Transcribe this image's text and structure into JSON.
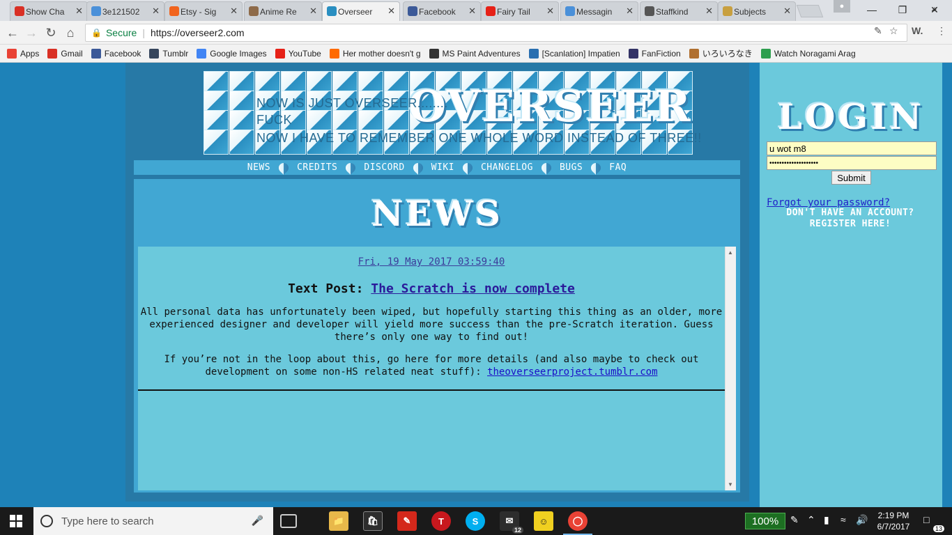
{
  "browser": {
    "tabs": [
      {
        "title": "Show Cha",
        "color": "#d93025"
      },
      {
        "title": "3e121502",
        "color": "#4a90d9"
      },
      {
        "title": "Etsy - Sig",
        "color": "#f1641e"
      },
      {
        "title": "Anime Re",
        "color": "#8e6b4a"
      },
      {
        "title": "Overseer",
        "color": "#2a8fc1",
        "active": true
      },
      {
        "title": "Facebook",
        "color": "#3b5998"
      },
      {
        "title": "Fairy Tail",
        "color": "#e62117"
      },
      {
        "title": "Messagin",
        "color": "#4a90d9"
      },
      {
        "title": "Staffkind",
        "color": "#555555"
      },
      {
        "title": "Subjects",
        "color": "#c8a040"
      }
    ],
    "secure_label": "Secure",
    "url": "https://overseer2.com",
    "bookmarks": [
      {
        "label": "Apps",
        "color": "#e94235"
      },
      {
        "label": "Gmail",
        "color": "#d93025"
      },
      {
        "label": "Facebook",
        "color": "#3b5998"
      },
      {
        "label": "Tumblr",
        "color": "#36465d"
      },
      {
        "label": "Google Images",
        "color": "#4285f4"
      },
      {
        "label": "YouTube",
        "color": "#e62117"
      },
      {
        "label": "Her mother doesn't g",
        "color": "#ff6a00"
      },
      {
        "label": "MS Paint Adventures",
        "color": "#333333"
      },
      {
        "label": "[Scanlation] Impatien",
        "color": "#2a6fb0"
      },
      {
        "label": "FanFiction",
        "color": "#333366"
      },
      {
        "label": "いろいろなき",
        "color": "#b07030"
      },
      {
        "label": "Watch Noragami Arag",
        "color": "#2e9e4f"
      }
    ]
  },
  "site": {
    "logo_text": "OVERSEER",
    "header_lines": [
      "NOW IS JUST OVERSEER........",
      "FUCK",
      "NOW I HAVE TO REMEMBER ONE WHOLE WORD INSTEAD OF THREE!!"
    ],
    "nav": [
      "NEWS",
      "CREDITS",
      "DISCORD",
      "WIKI",
      "CHANGELOG",
      "BUGS",
      "FAQ"
    ],
    "news_title": "NEWS",
    "post": {
      "date": "Fri, 19 May 2017 03:59:40",
      "type_label": "Text Post:",
      "title": "The Scratch is now complete",
      "para1": "All personal data has unfortunately been wiped, but hopefully starting this thing as an older, more experienced designer and developer will yield more success than the pre-Scratch iteration. Guess there’s only one way to find out!",
      "para2": "If you’re not in the loop about this, go here for more details (and also maybe to check out development on some non-HS related neat stuff): ",
      "link": "theoverseerproject.tumblr.com"
    },
    "login": {
      "title": "LOGIN",
      "username": "u wot m8",
      "password": "••••••••••••••••••••",
      "submit": "Submit",
      "forgot": "Forgot your password?",
      "register": "DON'T HAVE AN ACCOUNT? REGISTER HERE!"
    }
  },
  "taskbar": {
    "search_placeholder": "Type here to search",
    "zoom": "100%",
    "time": "2:19 PM",
    "date": "6/7/2017",
    "notifications": "13",
    "mail_badge": "12"
  }
}
